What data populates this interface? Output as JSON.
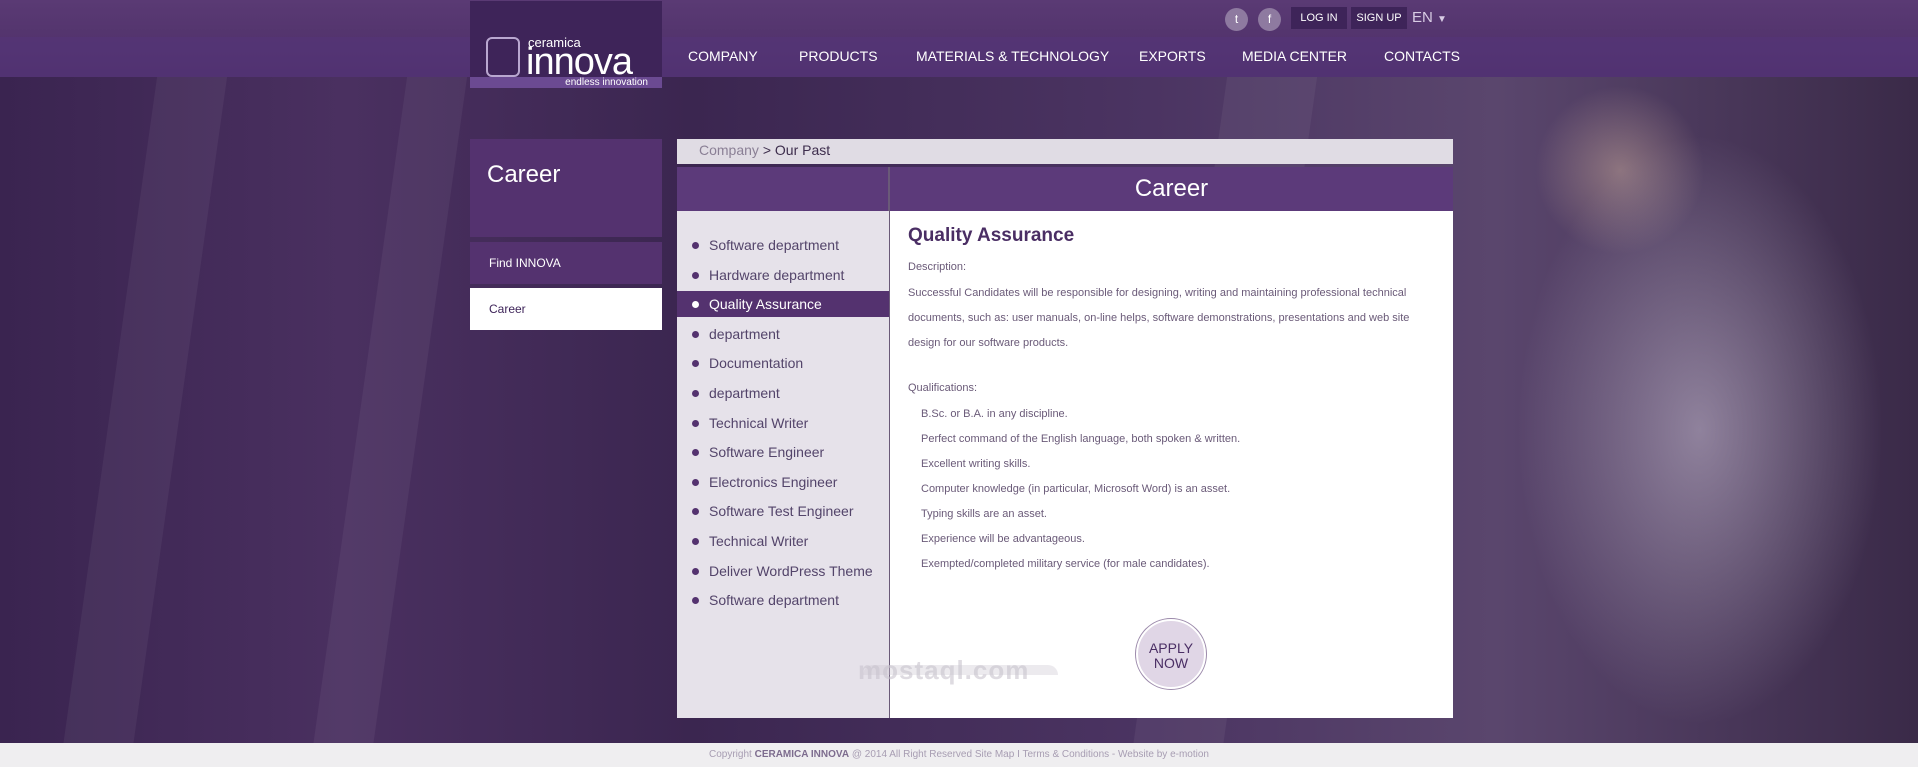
{
  "logo": {
    "brand_small": "ceramica",
    "brand_big": "innova",
    "tagline": "endless innovation"
  },
  "header": {
    "social": [
      {
        "icon": "twitter-icon",
        "glyph": "t"
      },
      {
        "icon": "facebook-icon",
        "glyph": "f"
      }
    ],
    "login": "LOG IN",
    "signup": "SIGN UP",
    "language": "EN",
    "nav": [
      "COMPANY",
      "PRODUCTS",
      "MATERIALS & TECHNOLOGY",
      "EXPORTS",
      "MEDIA CENTER",
      "CONTACTS"
    ]
  },
  "sidebar": {
    "title": "Career",
    "items": [
      {
        "label": "Find INNOVA"
      },
      {
        "label": "Career"
      }
    ]
  },
  "breadcrumb": {
    "parent": "Company",
    "separator": ">",
    "current": "Our Past"
  },
  "card": {
    "title": "Career",
    "jobs": [
      "Software department",
      "Hardware department",
      "Quality Assurance",
      "department",
      "Documentation",
      "department",
      "Technical Writer",
      "Software Engineer",
      "Electronics Engineer",
      "Software Test Engineer",
      "Technical Writer",
      "Deliver WordPress Theme",
      "Software department"
    ],
    "active_job": "Quality Assurance"
  },
  "detail": {
    "title": "Quality Assurance",
    "description_label": "Description:",
    "description": "Successful Candidates will be responsible for designing, writing and maintaining professional technical documents, such as: user manuals, on-line helps, software demonstrations, presentations and  web site design for our software products.",
    "qualifications_label": "Qualifications:",
    "qualifications": [
      "B.Sc. or B.A. in any discipline.",
      "Perfect command of the English language, both spoken & written.",
      "Excellent writing skills.",
      "Computer knowledge (in particular, Microsoft Word) is an asset.",
      "Typing skills are an asset.",
      "Experience will be advantageous.",
      "Exempted/completed military service (for male candidates)."
    ],
    "apply_line1": "APPLY",
    "apply_line2": "NOW"
  },
  "watermark": {
    "text": "mostaql.com"
  },
  "footer": {
    "prefix": "Copyright",
    "brand": "CERAMICA INNOVA",
    "rest": "@ 2014 All Right Reserved Site Map I Terms & Conditions - Website by e-motion"
  },
  "colors": {
    "primary": "#54326f",
    "header": "#4c2e66",
    "accent_text": "#4a2e64"
  }
}
